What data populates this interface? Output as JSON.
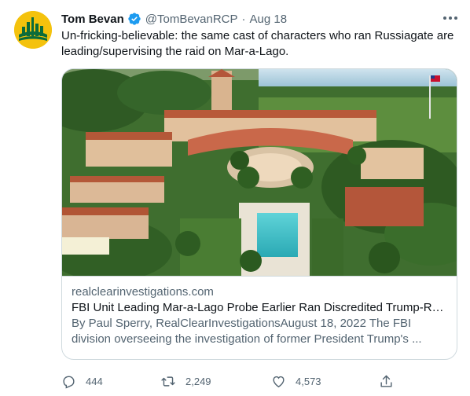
{
  "tweet": {
    "author_name": "Tom Bevan",
    "author_handle": "@TomBevanRCP",
    "separator": "·",
    "date": "Aug 18",
    "text": "Un-fricking-believable: the same cast of characters who ran Russiagate are leading/supervising the raid on Mar-a-Lago."
  },
  "card": {
    "domain": "realclearinvestigations.com",
    "headline": "FBI Unit Leading Mar-a-Lago Probe Earlier Ran Discredited Trump-Rus...",
    "description": "By Paul Sperry, RealClearInvestigationsAugust 18, 2022 The FBI division overseeing the investigation of former President Trump's ..."
  },
  "actions": {
    "replies": "444",
    "retweets": "2,249",
    "likes": "4,573"
  },
  "icons": {
    "verified": "verified-badge-icon",
    "more": "more-icon",
    "reply": "reply-icon",
    "retweet": "retweet-icon",
    "like": "heart-icon",
    "share": "share-icon"
  },
  "colors": {
    "text": "#0f1419",
    "secondary": "#536471",
    "verified": "#1d9bf0",
    "avatar_yellow": "#f4c20d",
    "avatar_green": "#0b6b3a",
    "border": "#cfd9de"
  }
}
